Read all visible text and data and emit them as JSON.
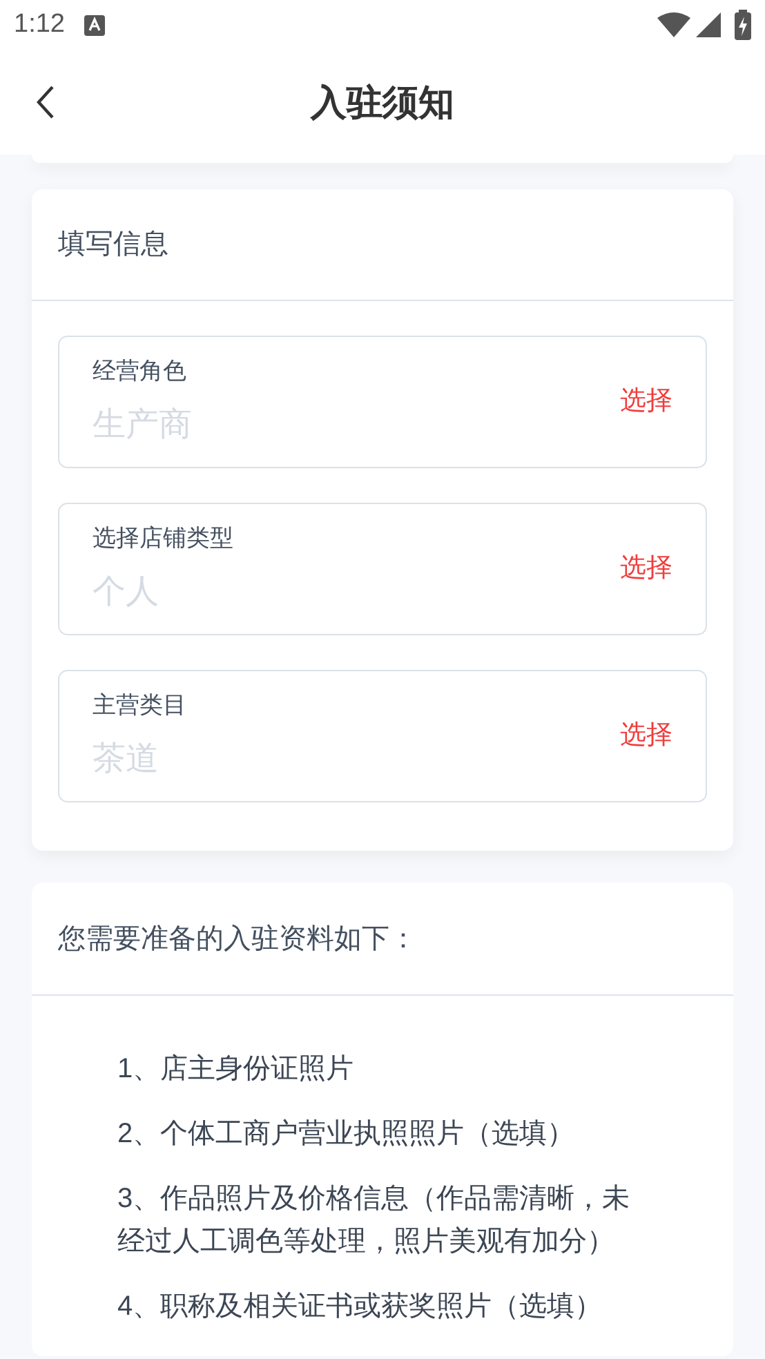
{
  "status_bar": {
    "time": "1:12"
  },
  "header": {
    "title": "入驻须知"
  },
  "form": {
    "title": "填写信息",
    "fields": [
      {
        "label": "经营角色",
        "placeholder": "生产商",
        "action": "选择"
      },
      {
        "label": "选择店铺类型",
        "placeholder": "个人",
        "action": "选择"
      },
      {
        "label": "主营类目",
        "placeholder": "茶道",
        "action": "选择"
      }
    ]
  },
  "requirements": {
    "title": "您需要准备的入驻资料如下：",
    "items": [
      "1、店主身份证照片",
      "2、个体工商户营业执照照片（选填）",
      "3、作品照片及价格信息（作品需清晰，未经过人工调色等处理，照片美观有加分）",
      "4、职称及相关证书或获奖照片（选填）"
    ]
  }
}
